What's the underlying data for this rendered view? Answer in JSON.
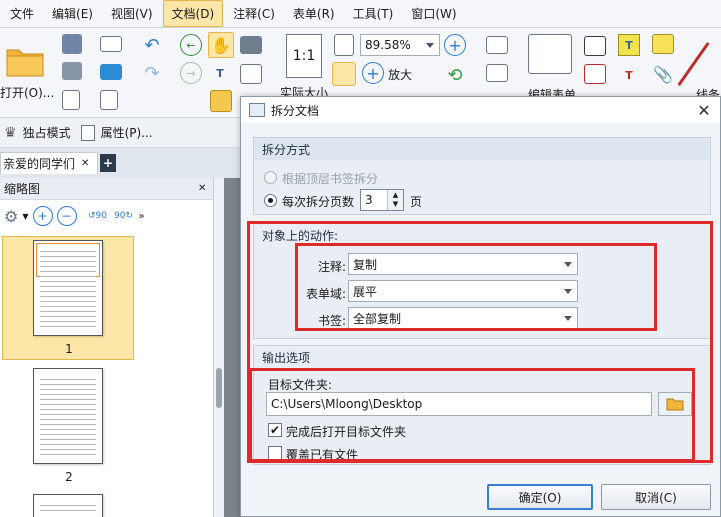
{
  "menubar": {
    "items": [
      "文件",
      "编辑(E)",
      "视图(V)",
      "文档(D)",
      "注释(C)",
      "表单(R)",
      "工具(T)",
      "窗口(W)"
    ],
    "active_index": 3
  },
  "ribbon": {
    "open_label": "打开(O)...",
    "zoom_value": "89.58%",
    "actual_size_label": "实际大小",
    "zoom_in_label": "放大",
    "edit_form_label": "编辑表单",
    "linestyle_label": "线条"
  },
  "modebar": {
    "exclusive_label": "独占模式",
    "properties_label": "属性(P)..."
  },
  "tabs": {
    "doc_tab_label": "亲爱的同学们"
  },
  "thumbnails": {
    "title": "缩略图",
    "pages": [
      "1",
      "2"
    ],
    "selected_index": 0
  },
  "dialog": {
    "title": "拆分文档",
    "split_method": {
      "heading": "拆分方式",
      "option_bookmarks": "根据顶层书签拆分",
      "option_pages": "每次拆分页数",
      "pages_value": "3",
      "pages_unit": "页",
      "selected": "pages"
    },
    "actions": {
      "heading": "对象上的动作:",
      "annotations_label": "注释:",
      "annotations_value": "复制",
      "formfields_label": "表单域:",
      "formfields_value": "展平",
      "bookmarks_label": "书签:",
      "bookmarks_value": "全部复制"
    },
    "output": {
      "heading": "输出选项",
      "folder_label": "目标文件夹:",
      "folder_value": "C:\\Users\\Mloong\\Desktop",
      "open_after_label": "完成后打开目标文件夹",
      "open_after_checked": true,
      "overwrite_label": "覆盖已有文件",
      "overwrite_checked": false
    },
    "ok_label": "确定(O)",
    "cancel_label": "取消(C)"
  },
  "colors": {
    "highlight_red": "#e02a2a",
    "menu_active": "#fde7a8",
    "thumb_selected": "#fde7a8"
  }
}
